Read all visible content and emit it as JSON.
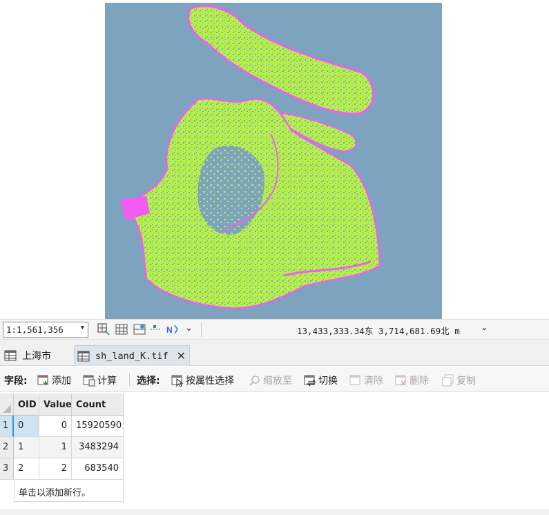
{
  "colors": {
    "water": "#7ea3bf",
    "land_green": "#b5f04a",
    "land_magenta": "#f25cf2"
  },
  "map_status": {
    "scale": "1:1,561,356",
    "coordinates": "13,433,333.34东  3,714,681.69北 m"
  },
  "tabs": [
    {
      "label": "上海市"
    },
    {
      "label": "sh_land_K.tif"
    }
  ],
  "toolbar": {
    "fields_label": "字段:",
    "add": "添加",
    "calculate": "计算",
    "select_label": "选择:",
    "select_by_attr": "按属性选择",
    "zoom_to": "缩放至",
    "switch": "切换",
    "clear": "清除",
    "delete": "删除",
    "copy": "复制"
  },
  "table": {
    "columns": [
      "OID",
      "Value",
      "Count"
    ],
    "rows": [
      {
        "num": "1",
        "oid": "0",
        "value": "0",
        "count": "15920590"
      },
      {
        "num": "2",
        "oid": "1",
        "value": "1",
        "count": "3483294"
      },
      {
        "num": "3",
        "oid": "2",
        "value": "2",
        "count": "683540"
      }
    ],
    "add_row_hint": "单击以添加新行。"
  }
}
